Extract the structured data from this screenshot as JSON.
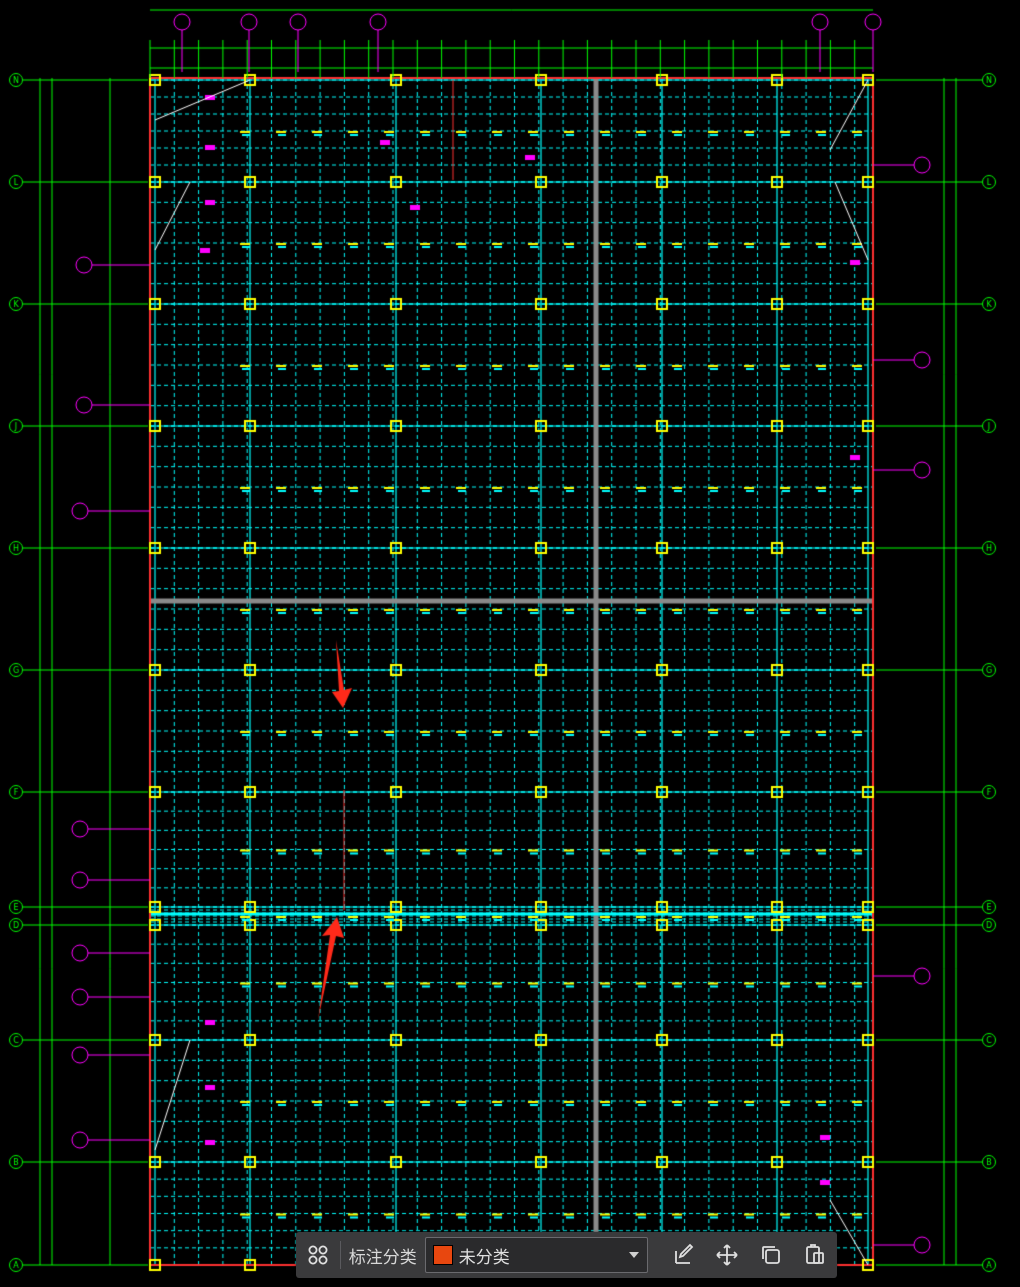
{
  "drawing": {
    "row_axes": [
      "N",
      "L",
      "K",
      "J",
      "H",
      "G",
      "F",
      "E",
      "D",
      "C",
      "B",
      "A"
    ],
    "accent_colors": {
      "grid": "#00ffff",
      "column": "#ffff00",
      "dimension": "#00ff00",
      "tag": "#ff00ff",
      "edge": "#ff3030",
      "arrow": "#ff2a1a"
    }
  },
  "toolbar": {
    "grid_icon": "grid-four-icon",
    "classify_label": "标注分类",
    "category_value": "未分类",
    "category_color": "#e8470f",
    "edit_icon": "edit-icon",
    "move_icon": "move-icon",
    "copy_icon": "copy-icon",
    "paste_icon": "paste-icon"
  }
}
